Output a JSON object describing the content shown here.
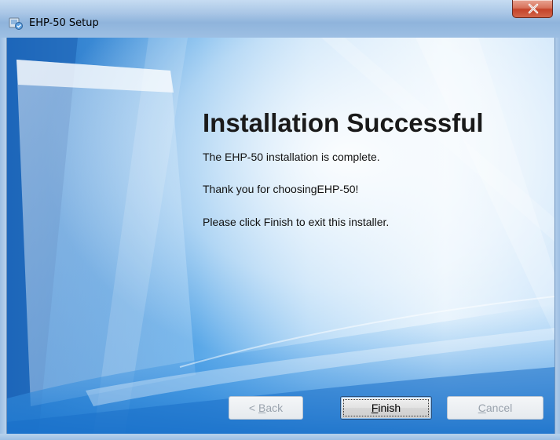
{
  "window": {
    "title": "EHP-50 Setup",
    "close_icon": "close-x-icon",
    "app_icon": "installer-icon"
  },
  "content": {
    "heading": "Installation Successful",
    "message_complete": "The EHP-50 installation is complete.",
    "message_thanks": "Thank you for choosingEHP-50!",
    "message_instructions": "Please click Finish to exit this installer."
  },
  "buttons": {
    "back": {
      "prefix": "< ",
      "mnemonic": "B",
      "rest": "ack",
      "enabled": false
    },
    "finish": {
      "prefix": "",
      "mnemonic": "F",
      "rest": "inish",
      "enabled": true,
      "focused": true
    },
    "cancel": {
      "prefix": "",
      "mnemonic": "C",
      "rest": "ancel",
      "enabled": false
    }
  },
  "colors": {
    "background_blue": "#1f7fd1",
    "text_disabled": "#9aa3ad",
    "title_bar": "#a9c6e6",
    "close_red": "#c4432a"
  }
}
